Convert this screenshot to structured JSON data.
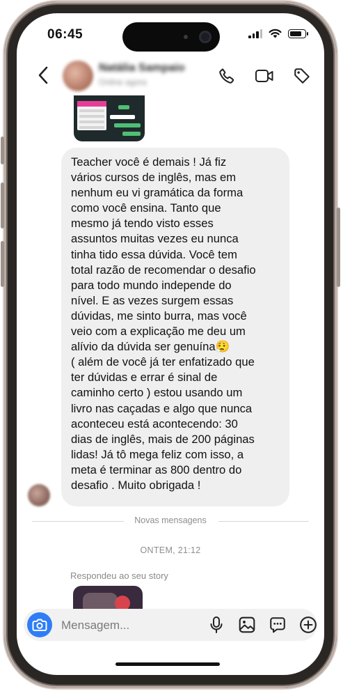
{
  "status_bar": {
    "time": "06:45"
  },
  "header": {
    "contact_name": "Natália Sampaio",
    "contact_status": "Online agora",
    "icons": [
      "back-arrow-icon",
      "phone-icon",
      "video-camera-icon",
      "tag-icon"
    ]
  },
  "chat": {
    "message_text": "Teacher você é demais ! Já fiz\nvários cursos de inglês, mas em\nnenhum eu vi gramática da forma\ncomo você ensina. Tanto que\nmesmo já tendo visto esses\nassuntos muitas vezes eu nunca\ntinha tido essa dúvida. Você tem\ntotal razão de recomendar o desafio\npara todo mundo independe do\nnível. E as vezes surgem essas\ndúvidas, me sinto burra, mas você\nveio com a explicação me deu um\nalívio da dúvida ser genuína😮‍💨\n( além de você já ter enfatizado que\nter dúvidas e errar é sinal de\ncaminho certo ) estou usando um\nlivro nas caçadas e algo que nunca\naconteceu está acontecendo: 30\ndias de inglês, mais de 200 páginas\nlidas! Já tô mega feliz com isso, a\nmeta é terminar as 800 dentro do\ndesafio . Muito obrigada !",
    "divider_label": "Novas mensagens",
    "timestamp": "ONTEM, 21:12",
    "replied_label": "Respondeu ao seu story"
  },
  "composer": {
    "placeholder": "Mensagem...",
    "icons": [
      "camera-icon",
      "microphone-icon",
      "gallery-icon",
      "sticker-chat-icon",
      "plus-circle-icon"
    ]
  },
  "colors": {
    "accent_blue": "#2e7df6",
    "bubble_bg": "#efefef",
    "meta_text": "#8e8e8e"
  }
}
